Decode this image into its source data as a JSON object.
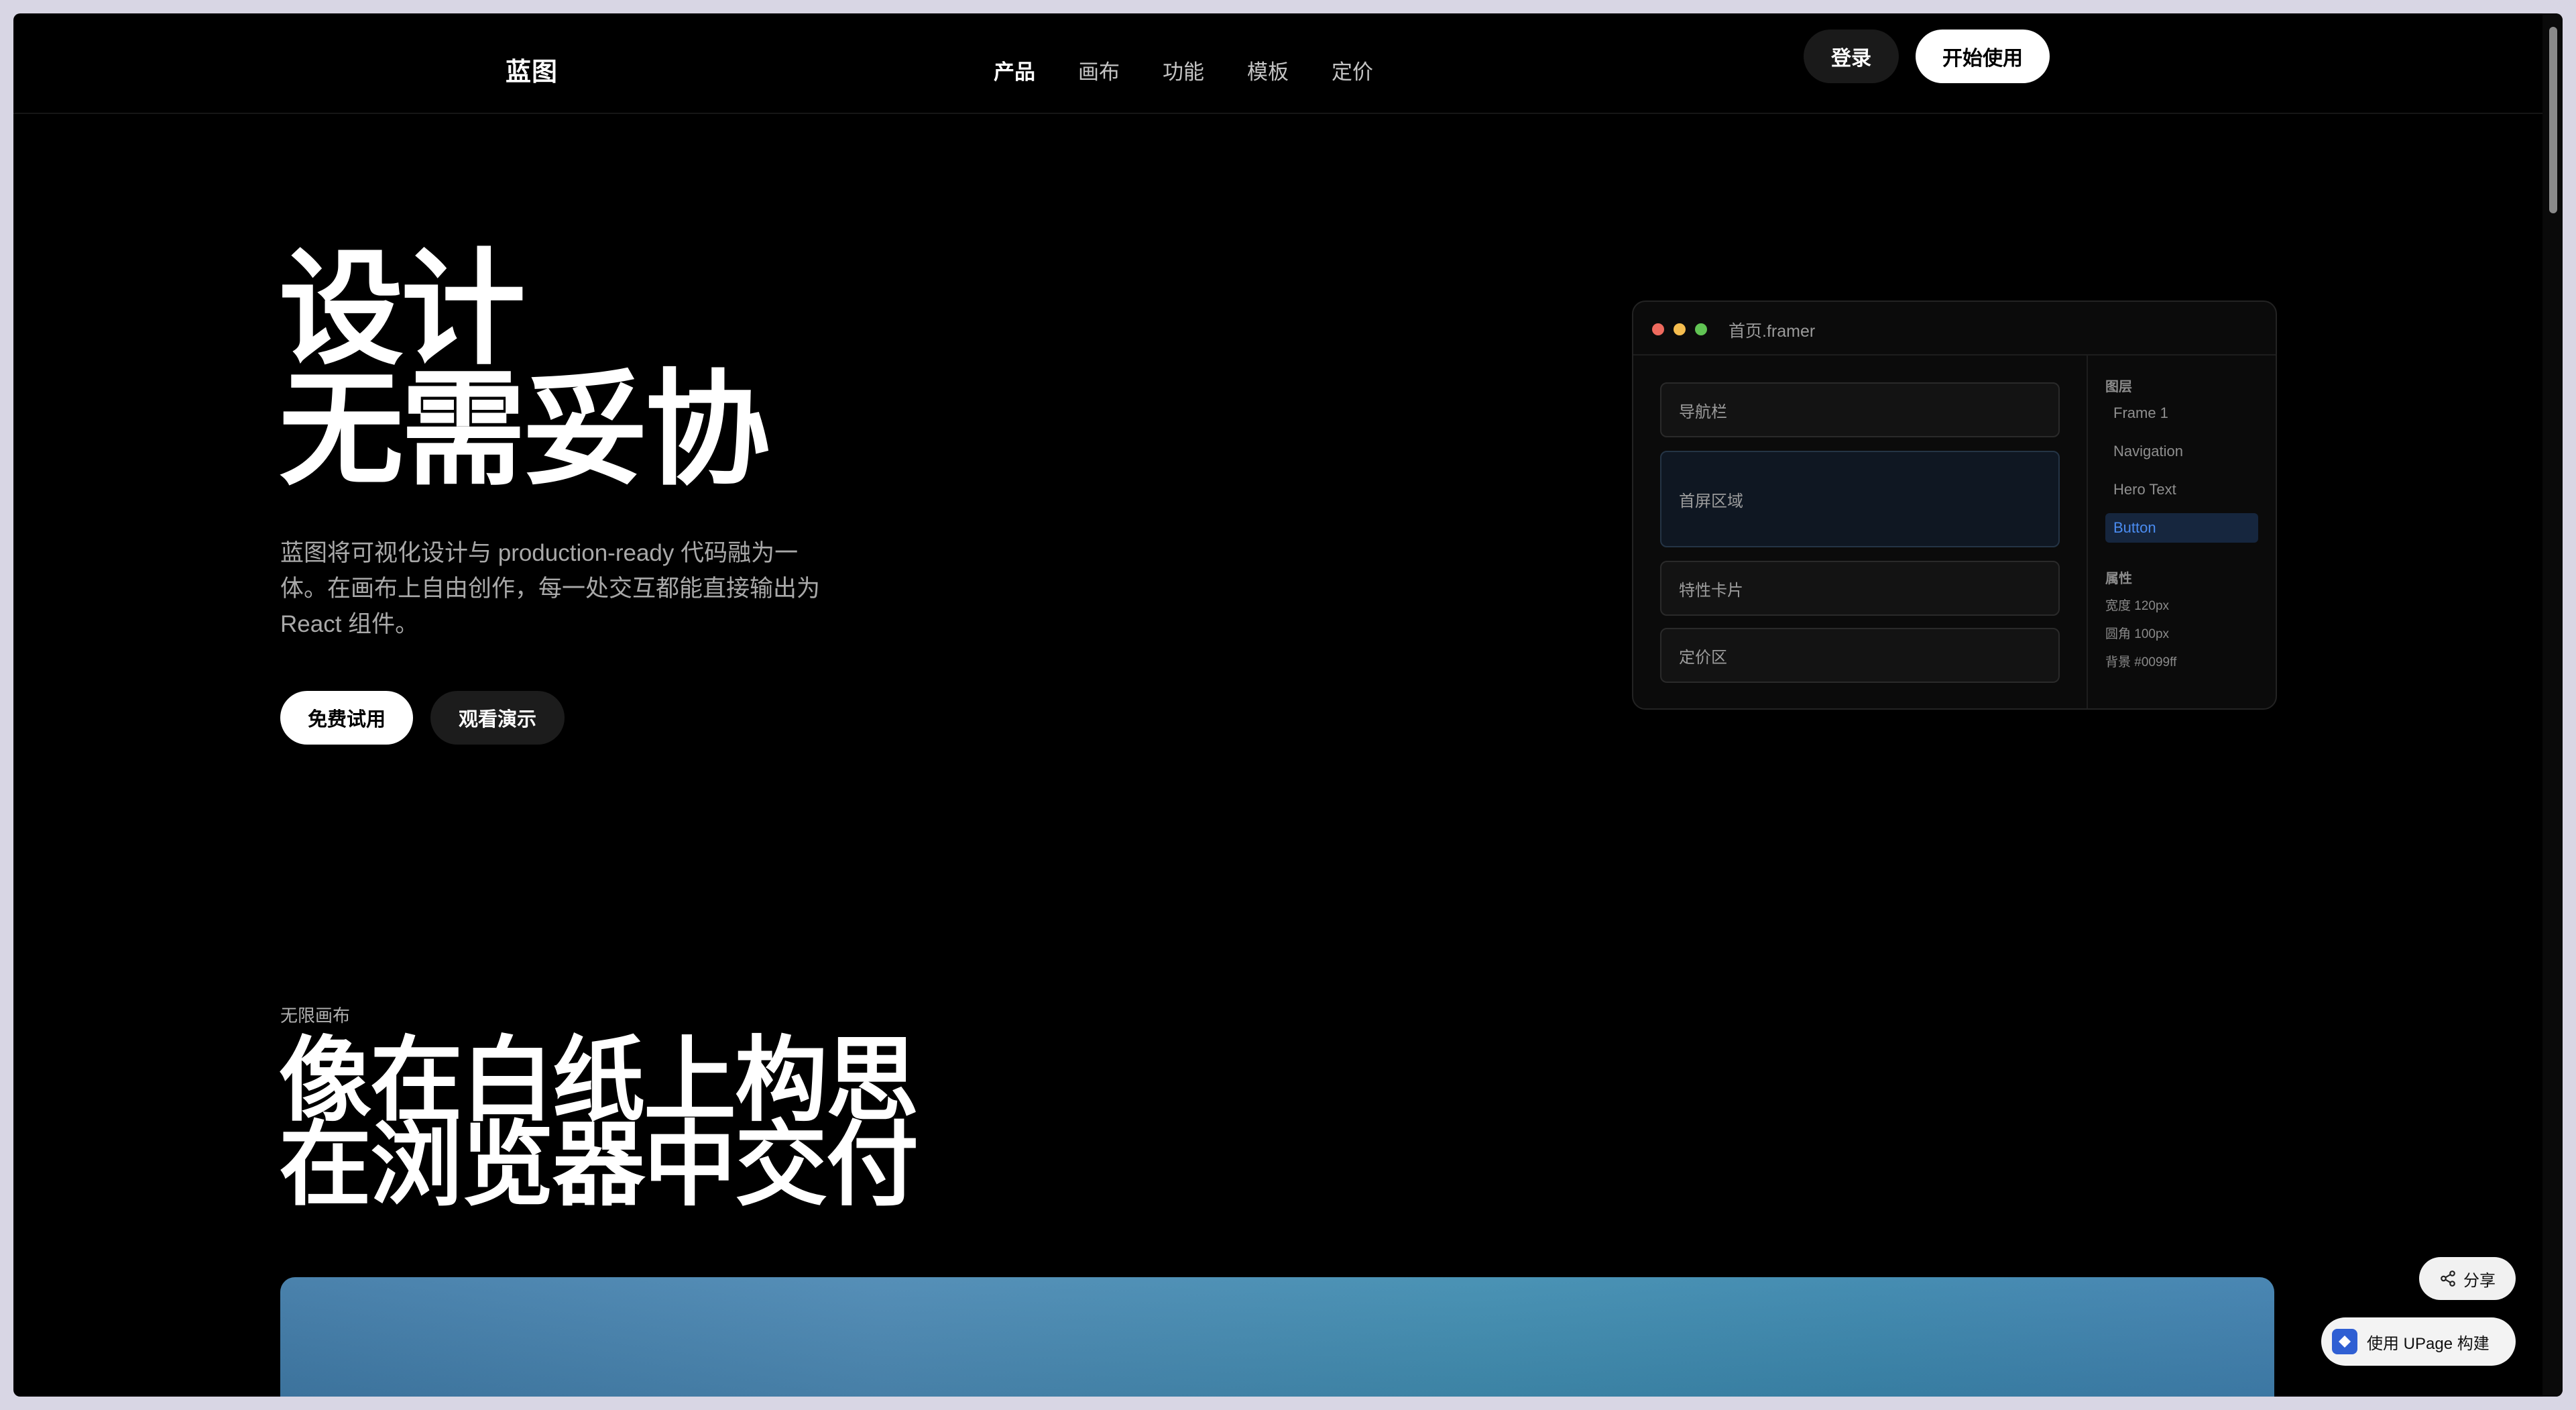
{
  "header": {
    "brand": "蓝图",
    "nav": [
      {
        "label": "产品",
        "active": true
      },
      {
        "label": "画布",
        "active": false
      },
      {
        "label": "功能",
        "active": false
      },
      {
        "label": "模板",
        "active": false
      },
      {
        "label": "定价",
        "active": false
      }
    ],
    "login_label": "登录",
    "start_label": "开始使用"
  },
  "hero": {
    "title_line1": "设计",
    "title_line2": "无需妥协",
    "description": "蓝图将可视化设计与 production-ready 代码融为一体。在画布上自由创作，每一处交互都能直接输出为 React 组件。",
    "primary_cta": "免费试用",
    "secondary_cta": "观看演示"
  },
  "editor_mock": {
    "file_name": "首页.framer",
    "dot_colors": [
      "#ee6a5e",
      "#f5bd4f",
      "#61c454"
    ],
    "blocks": [
      "导航栏",
      "首屏区域",
      "特性卡片",
      "定价区"
    ],
    "selected_block": "首屏区域",
    "layers_heading": "图层",
    "layers": [
      "Frame 1",
      "Navigation",
      "Hero Text",
      "Button"
    ],
    "selected_layer": "Button",
    "props_heading": "属性",
    "props": [
      "宽度 120px",
      "圆角 100px",
      "背景 #0099ff"
    ]
  },
  "section2": {
    "eyebrow": "无限画布",
    "title_line1": "像在白纸上构思",
    "title_line2": "在浏览器中交付"
  },
  "floating": {
    "share_label": "分享",
    "upage_label": "使用 UPage 构建"
  },
  "colors": {
    "background": "#000000",
    "accent_blue": "#4b8cf1"
  }
}
